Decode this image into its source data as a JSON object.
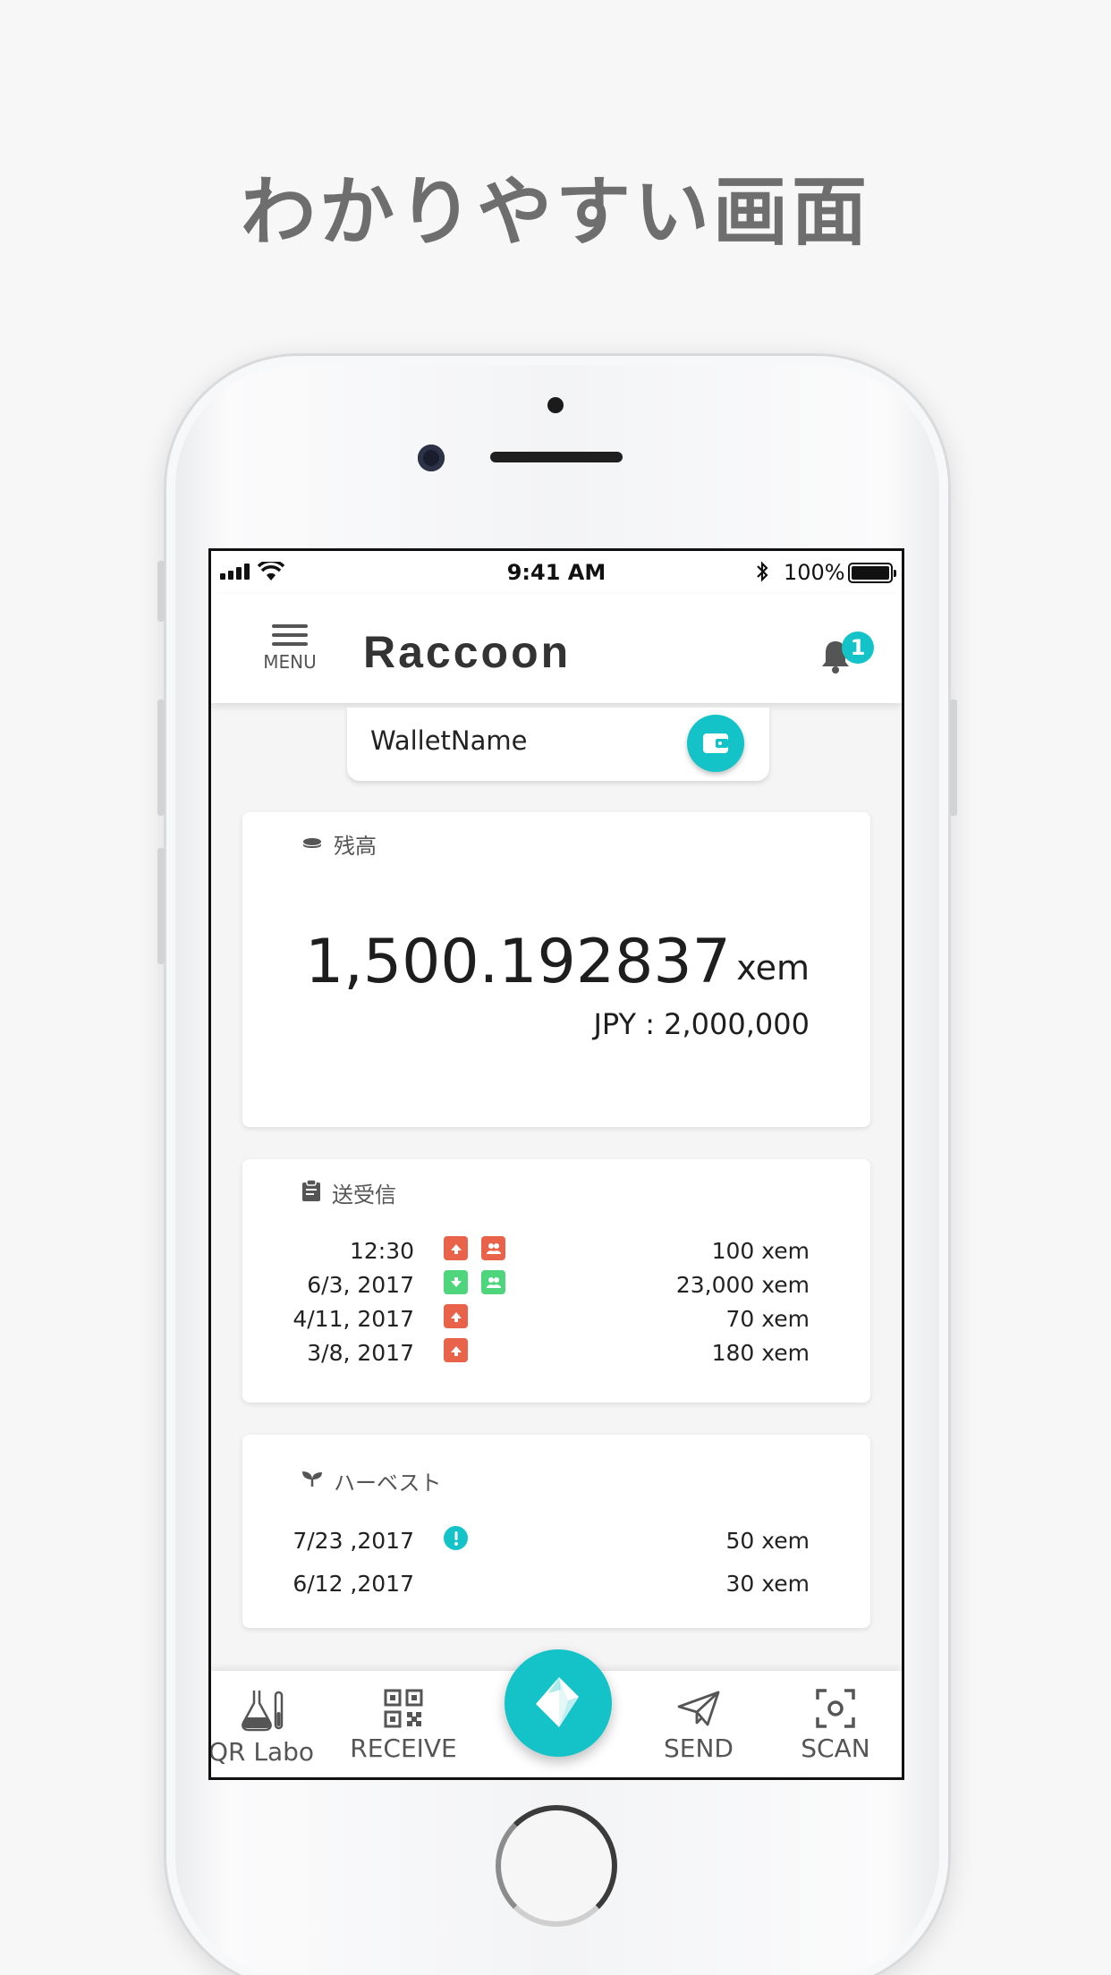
{
  "headline": "わかりやすい画面",
  "status_bar": {
    "time": "9:41 AM",
    "battery": "100%"
  },
  "app_bar": {
    "menu_label": "MENU",
    "title": "Raccoon",
    "notification_count": "1"
  },
  "wallet": {
    "name": "WalletName"
  },
  "balance": {
    "title": "残高",
    "amount": "1,500.192837",
    "unit": "xem",
    "jpy": "JPY : 2,000,000"
  },
  "transactions": {
    "title": "送受信",
    "rows": [
      {
        "date": "12:30",
        "amount": "100 xem",
        "icons": [
          "send",
          "multisig"
        ]
      },
      {
        "date": "6/3, 2017",
        "amount": "23,000 xem",
        "icons": [
          "receive",
          "multisig"
        ]
      },
      {
        "date": "4/11, 2017",
        "amount": "70 xem",
        "icons": [
          "send"
        ]
      },
      {
        "date": "3/8, 2017",
        "amount": "180 xem",
        "icons": [
          "send"
        ]
      }
    ]
  },
  "harvest": {
    "title": "ハーベスト",
    "rows": [
      {
        "date": "7/23 ,2017",
        "amount": "50 xem",
        "alert": true
      },
      {
        "date": "6/12 ,2017",
        "amount": "30 xem",
        "alert": false
      }
    ]
  },
  "bottom_nav": {
    "qr_labo": "QR Labo",
    "receive": "RECEIVE",
    "send": "SEND",
    "scan": "SCAN"
  },
  "colors": {
    "accent": "#13c3c8",
    "send_red": "#e8634a",
    "receive_green": "#4fd67c"
  }
}
